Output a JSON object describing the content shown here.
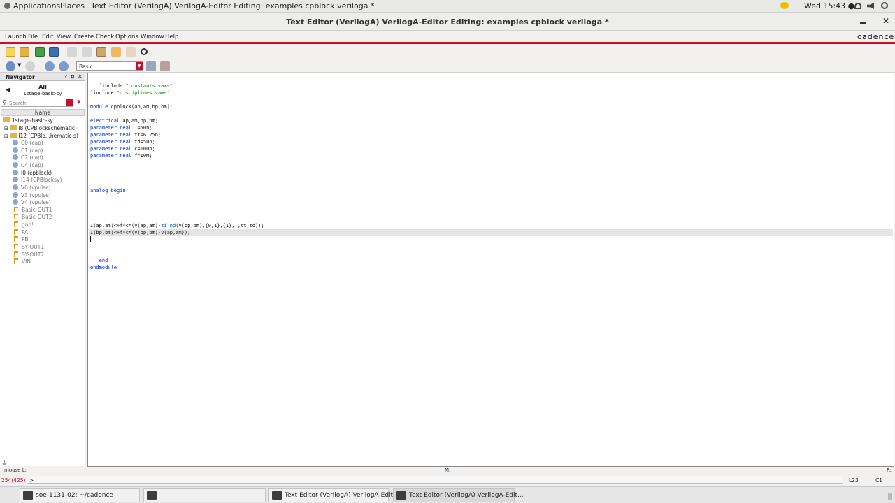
{
  "topbar": {
    "applications": "Applications",
    "places": "Places",
    "active_app": "Text Editor (VerilogA) VerilogA-Editor Editing: examples cpblock veriloga *",
    "clock": "Wed 15:43 ●"
  },
  "window": {
    "title": "Text Editor (VerilogA) VerilogA-Editor Editing: examples cpblock veriloga *",
    "brand": "cādence"
  },
  "menu": [
    "Launch",
    "File",
    "Edit",
    "View",
    "Create",
    "Check",
    "Options",
    "Window",
    "Help"
  ],
  "toolbar": {
    "combo_value": "Basic"
  },
  "navigator": {
    "title": "Navigator",
    "scope": "All",
    "cell": "1stage-basic-sy",
    "search_placeholder": "Search",
    "column": "Name",
    "tree": [
      "1stage-basic-sy",
      "I8 (CPBlockschematic)",
      "I12 (CPBlo...hematic-s)",
      "C0 (cap)",
      "C1 (cap)",
      "C2 (cap)",
      "C4 (cap)",
      "I0 (cpblock)",
      "I14 (CPBlocksy)",
      "V0 (vpulse)",
      "V3 (vpulse)",
      "V4 (vpulse)",
      "Basic-OUT1",
      "Basic-OUT2",
      "gnd!",
      "PA",
      "PB",
      "SY-OUT1",
      "SY-OUT2",
      "VIN"
    ]
  },
  "code": {
    "l1a": "   `include ",
    "l1b": "\"constants.vams\"",
    "l2a": "`include ",
    "l2b": "\"disciplines.vams\"",
    "l3a": "module",
    " l3b": " cpblock(ap,am,bp,bm);",
    "l4a": "electrical",
    "l4b": " ap,am,bp,bm;",
    "p": "parameter",
    "r": " real",
    "p1": " T=50n;",
    "p2": " tt=6.25n;",
    "p3": " td=50n;",
    "p4": " c=100p;",
    "p5": " f=10M;",
    "ab": "analog begin",
    "e1a": "I(ap,am)<+f*c*(V(ap,am)-",
    "e1b": "zi_nd",
    "e1c": "(V(bp,bm),{0,1},{1},T,tt,td));",
    "e2": "I(bp,bm)<+f*c*(V(bp,bm)-V(ap,am));",
    "end": "   end",
    "endm": "endmodule"
  },
  "status": {
    "mouse_l": "mouse L:",
    "mouse_m": "M:",
    "mouse_r": "R:",
    "counter": "254(425)",
    "prompt": ">",
    "line": "L23",
    "col": "C1"
  },
  "taskbar": [
    "soe-1131-02: ~/cadence",
    "",
    "Text Editor (VerilogA) VerilogA-Edit...",
    "Text Editor (VerilogA) VerilogA-Edit..."
  ]
}
